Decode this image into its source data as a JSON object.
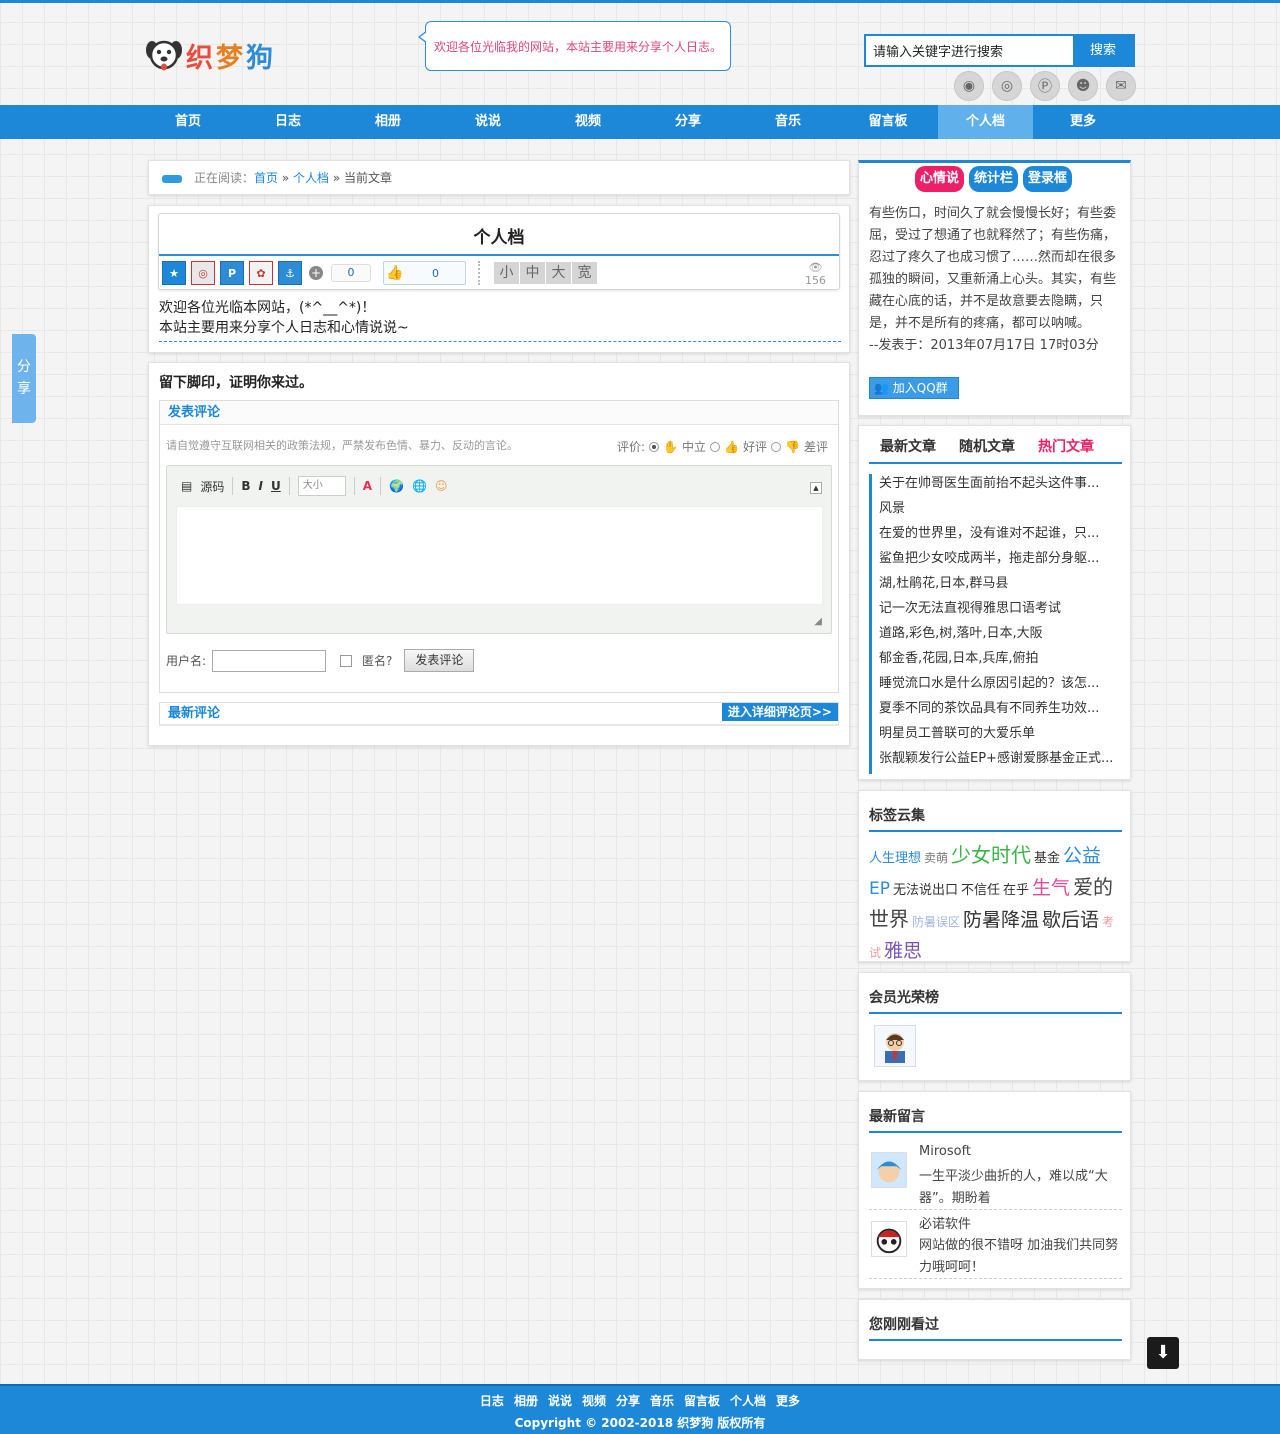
{
  "header": {
    "logo_text": "织梦狗",
    "welcome_bubble": "欢迎各位光临我的网站，本站主要用来分享个人日志。",
    "search_placeholder": "请输入关键字进行搜索",
    "search_button": "搜索",
    "social_icons": [
      "rss-icon",
      "weibo-icon",
      "pinterest-icon",
      "qq-penguin-icon",
      "mail-icon"
    ]
  },
  "nav": {
    "items": [
      "首页",
      "日志",
      "相册",
      "说说",
      "视频",
      "分享",
      "音乐",
      "留言板",
      "个人档",
      "更多"
    ],
    "active": "个人档"
  },
  "breadcrumb": {
    "prefix": "正在阅读：",
    "home": "首页",
    "sep1": "»",
    "category": "个人档",
    "sep2": "»",
    "current": "当前文章"
  },
  "article": {
    "title": "个人档",
    "plus_count": "0",
    "like_count": "0",
    "font_sizes": [
      "小",
      "中",
      "大",
      "宽"
    ],
    "views": "156",
    "body_line1": "欢迎各位光临本网站，(*^__^*)！",
    "body_line2": "本站主要用来分享个人日志和心情说说~"
  },
  "comment": {
    "heading": "留下脚印，证明你来过。",
    "bar_title": "发表评论",
    "notice": "请自觉遵守互联网相关的政策法规，严禁发布色情、暴力、反动的言论。",
    "rating_label": "评价:",
    "rating_options": [
      "中立",
      "好评",
      "差评"
    ],
    "editor_source": "源码",
    "editor_bold": "B",
    "editor_italic": "I",
    "editor_underline": "U",
    "editor_size": "大小",
    "editor_color": "A",
    "username_label": "用户名:",
    "anonymous_label": "匿名?",
    "submit_label": "发表评论",
    "latest_title": "最新评论",
    "detail_link": "进入详细评论页>>"
  },
  "sidebar": {
    "pills": [
      "心情说",
      "统计栏",
      "登录框"
    ],
    "mood_text": "有些伤口，时间久了就会慢慢长好；有些委屈，受过了想通了也就释然了；有些伤痛，忍过了疼久了也成习惯了……然而却在很多孤独的瞬间，又重新涌上心头。其实，有些藏在心底的话，并不是故意要去隐瞒，只是，并不是所有的疼痛，都可以呐喊。",
    "mood_date": "--发表于：2013年07月17日 17时03分",
    "qq_group": "加入QQ群",
    "article_tabs": [
      "最新文章",
      "随机文章",
      "热门文章"
    ],
    "articles": [
      "关于在帅哥医生面前抬不起头这件事...",
      "风景",
      "在爱的世界里，没有谁对不起谁，只...",
      "鲨鱼把少女咬成两半，拖走部分身躯...",
      "湖,杜鹃花,日本,群马县",
      "记一次无法直视得雅思口语考试",
      "道路,彩色,树,落叶,日本,大阪",
      "郁金香,花园,日本,兵库,俯拍",
      "睡觉流口水是什么原因引起的？该怎...",
      "夏季不同的茶饮品具有不同养生功效...",
      "明星员工普联可的大爱乐单",
      "张靓颖发行公益EP+感谢爱豚基金正式..."
    ],
    "tags_title": "标签云集",
    "tags": [
      {
        "t": "人生理想",
        "c": "#2e8bd6",
        "s": "13px"
      },
      {
        "t": "卖萌",
        "c": "#777",
        "s": "12px"
      },
      {
        "t": "少女时代",
        "c": "#3bb54a",
        "s": "20px"
      },
      {
        "t": "基金",
        "c": "#333",
        "s": "13px"
      },
      {
        "t": "公益",
        "c": "#2e8bd6",
        "s": "19px"
      },
      {
        "t": "EP",
        "c": "#2e8bd6",
        "s": "17px"
      },
      {
        "t": "无法说出口",
        "c": "#333",
        "s": "13px"
      },
      {
        "t": "不信任",
        "c": "#333",
        "s": "13px"
      },
      {
        "t": "在乎",
        "c": "#333",
        "s": "13px"
      },
      {
        "t": "生气",
        "c": "#e04a9c",
        "s": "19px"
      },
      {
        "t": "爱的世界",
        "c": "#444",
        "s": "20px"
      },
      {
        "t": "防暑误区",
        "c": "#a0b6e0",
        "s": "12px"
      },
      {
        "t": "防暑降温",
        "c": "#333",
        "s": "19px"
      },
      {
        "t": "歇后语",
        "c": "#333",
        "s": "19px"
      },
      {
        "t": "考试",
        "c": "#f09aa0",
        "s": "12px"
      },
      {
        "t": "雅思",
        "c": "#7a55b8",
        "s": "19px"
      }
    ],
    "members_title": "会员光荣榜",
    "messages_title": "最新留言",
    "messages": [
      {
        "user": "Mirosoft",
        "text": "一生平淡少曲折的人，难以成“大器”。期盼着"
      },
      {
        "user": "必诺软件",
        "text": "网站做的很不错呀 加油我们共同努力哦呵呵！"
      }
    ],
    "seen_title": "您刚刚看过"
  },
  "share_tab": [
    "分",
    "享"
  ],
  "footer": {
    "links": [
      "日志",
      "相册",
      "说说",
      "视频",
      "分享",
      "音乐",
      "留言板",
      "个人档",
      "更多"
    ],
    "copyright": "Copyright © 2002-2018 织梦狗 版权所有"
  },
  "colors": {
    "primary": "#1e88d8",
    "accent_pink": "#ec1f68"
  }
}
